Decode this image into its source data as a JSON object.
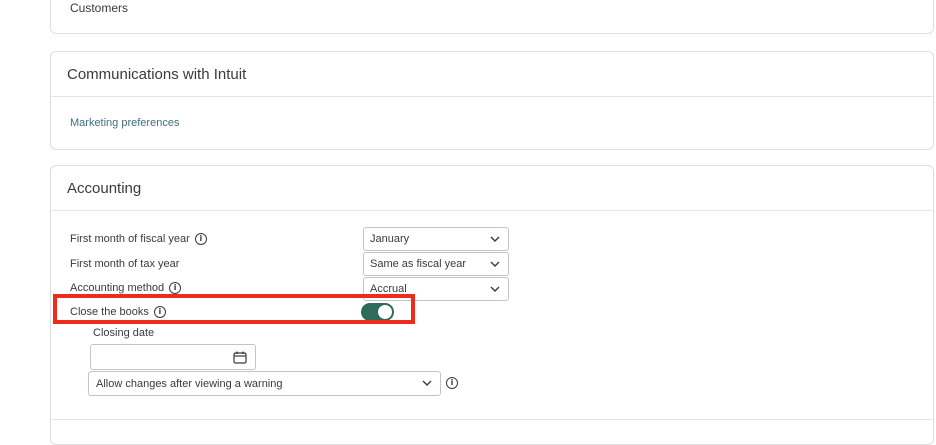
{
  "customers_card": {
    "label": "Customers"
  },
  "communications": {
    "title": "Communications with Intuit",
    "link": "Marketing preferences"
  },
  "accounting": {
    "title": "Accounting",
    "rows": [
      {
        "label": "First month of fiscal year",
        "value": "January"
      },
      {
        "label": "First month of tax year",
        "value": "Same as fiscal year"
      },
      {
        "label": "Accounting method",
        "value": "Accrual"
      }
    ],
    "close_books": {
      "label": "Close the books",
      "enabled": true,
      "closing_date_label": "Closing date",
      "closing_date_value": "",
      "changes_option": "Allow changes after viewing a warning"
    }
  },
  "colors": {
    "toggle_on": "#2e6b58",
    "highlight": "#ee2c1b",
    "link": "#3f6f80"
  }
}
